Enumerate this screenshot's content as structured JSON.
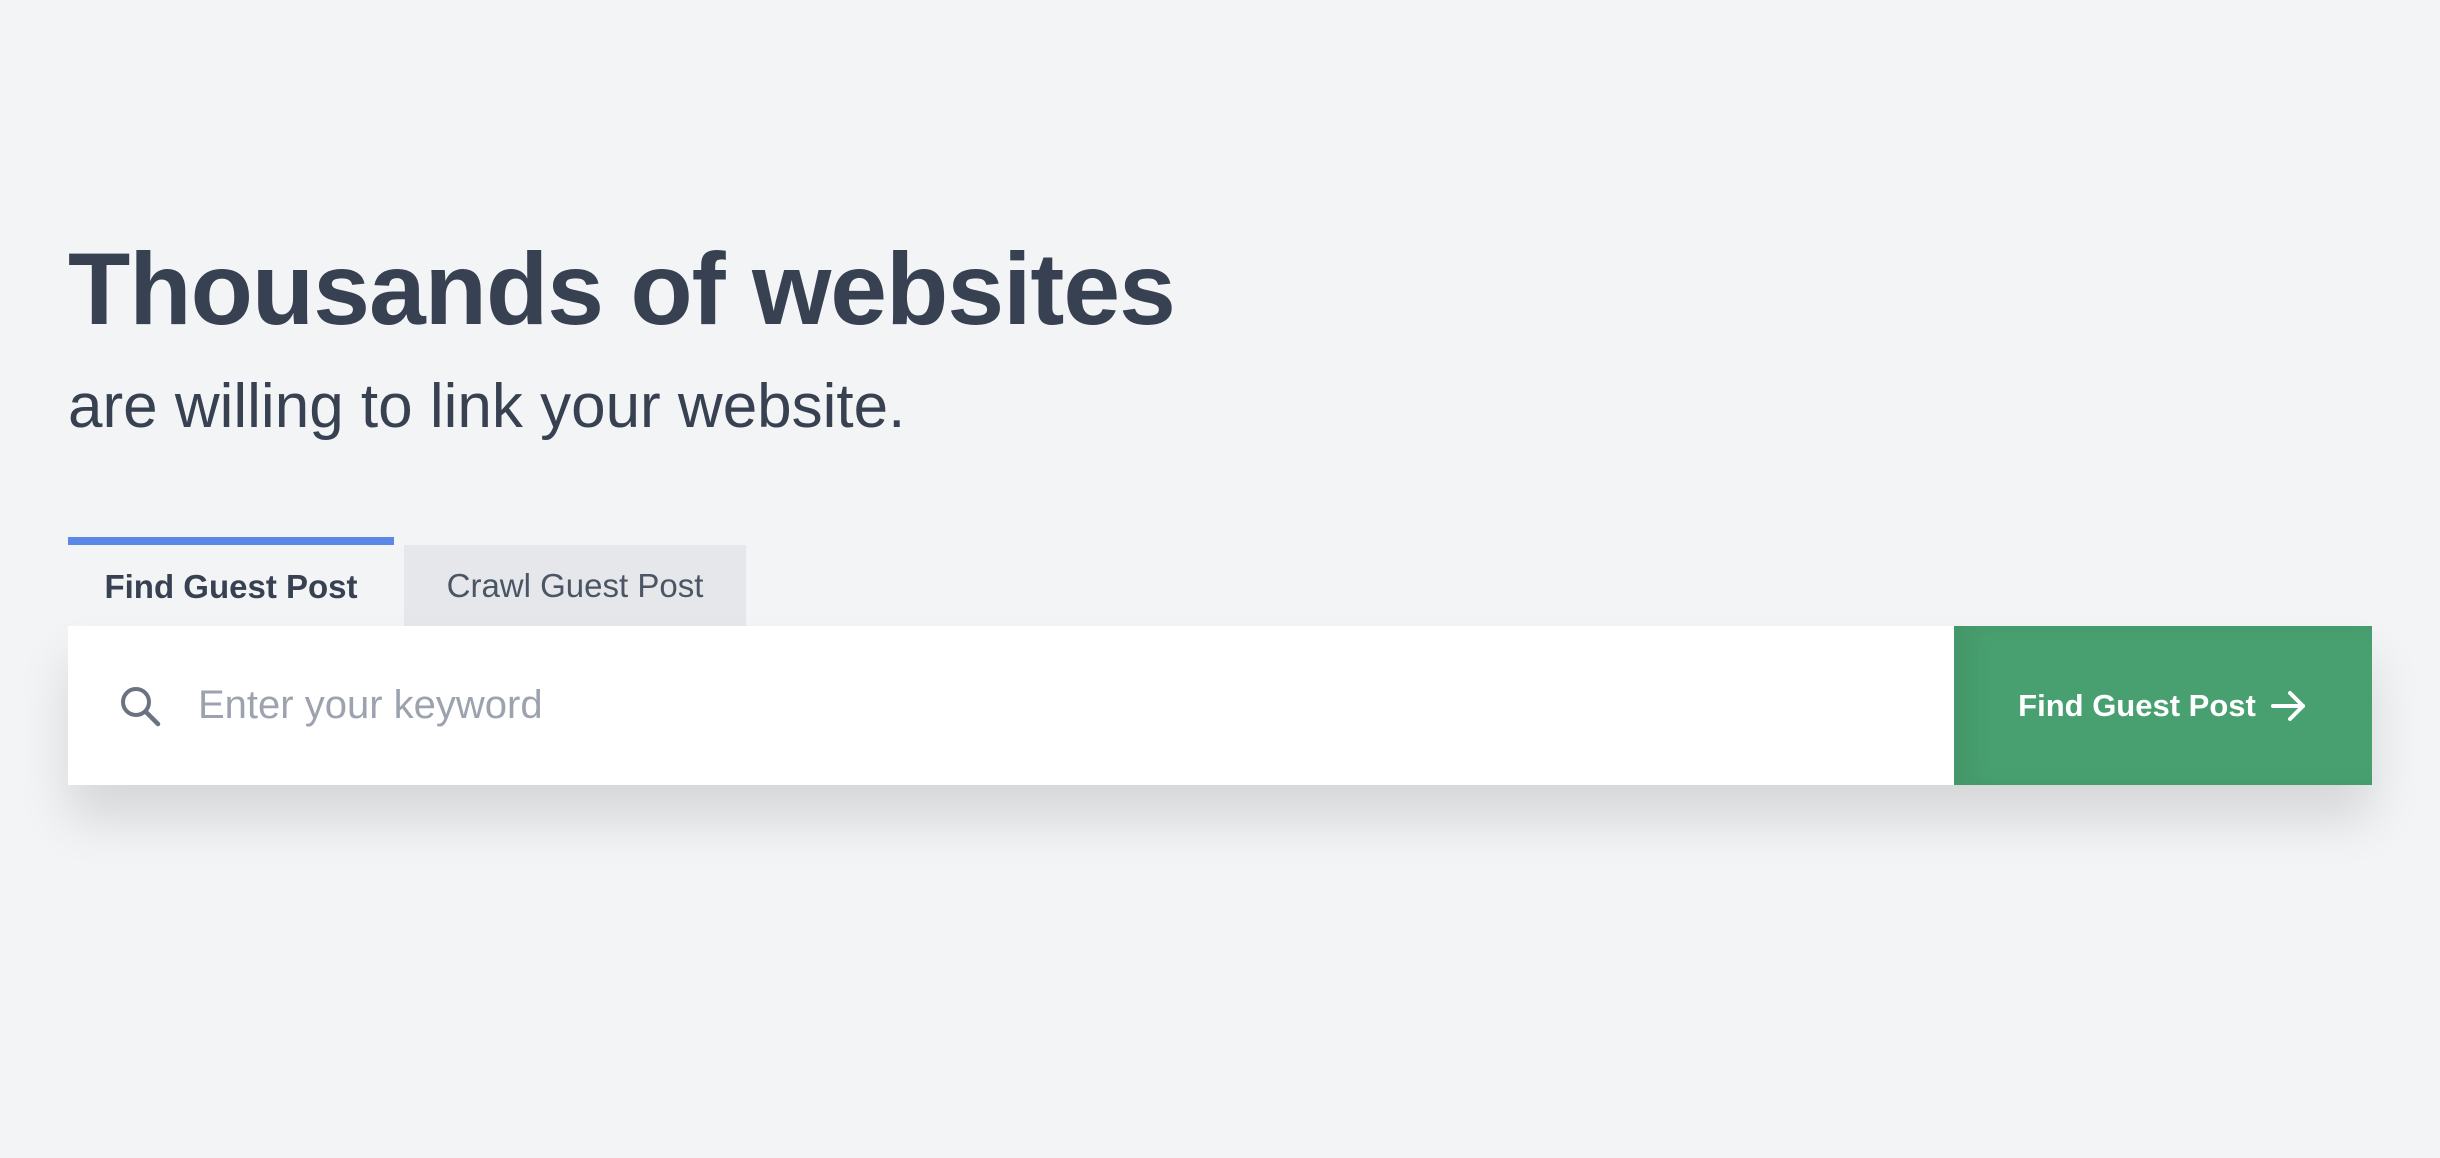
{
  "hero": {
    "headline": "Thousands of websites",
    "subheadline": "are willing to link your website."
  },
  "tabs": [
    {
      "label": "Find Guest Post",
      "active": true
    },
    {
      "label": "Crawl Guest Post",
      "active": false
    }
  ],
  "search": {
    "placeholder": "Enter your keyword",
    "value": "",
    "icon": "search-icon",
    "button_label": "Find Guest Post",
    "button_icon": "arrow-right-icon"
  },
  "colors": {
    "background": "#f3f4f6",
    "text": "#374151",
    "active_tab_accent": "#5b87e8",
    "inactive_tab": "#e5e7eb",
    "button": "#48a070",
    "placeholder": "#9ca3af"
  }
}
